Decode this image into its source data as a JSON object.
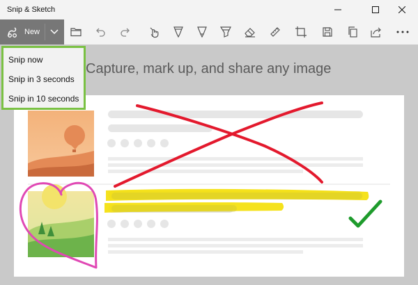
{
  "titlebar": {
    "title": "Snip & Sketch"
  },
  "toolbar": {
    "new_label": "New",
    "tools": [
      "folder-icon",
      "undo-icon",
      "redo-icon",
      "touch-writing-icon",
      "ballpoint-pen-icon",
      "pencil-icon",
      "highlighter-icon",
      "eraser-icon",
      "ruler-icon",
      "crop-icon",
      "save-icon",
      "copy-icon",
      "share-icon",
      "more-icon"
    ]
  },
  "new_menu": {
    "items": [
      "Snip now",
      "Snip in 3 seconds",
      "Snip in 10 seconds"
    ]
  },
  "canvas": {
    "headline": "Capture, mark up, and share any image"
  },
  "colors": {
    "accent_outline": "#7ac143",
    "red_ink": "#e3192d",
    "yellow_ink": "#f4e00a",
    "green_check": "#1e9b2c",
    "pink_heart": "#e048b4"
  }
}
